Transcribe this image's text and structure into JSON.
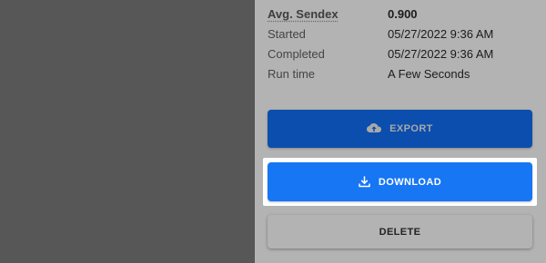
{
  "stats": [
    {
      "label": "Avg. Sendex",
      "value": "0.900"
    },
    {
      "label": "Started",
      "value": "05/27/2022 9:36 AM"
    },
    {
      "label": "Completed",
      "value": "05/27/2022 9:36 AM"
    },
    {
      "label": "Run time",
      "value": "A Few Seconds"
    }
  ],
  "actions": {
    "export_label": "EXPORT",
    "export_icon": "cloud-upload-icon",
    "download_label": "DOWNLOAD",
    "download_icon": "download-icon",
    "delete_label": "DELETE"
  },
  "colors": {
    "export_bg": "#0b4eae",
    "download_bg": "#1676f3",
    "panel_bg": "#b3b3b3",
    "overlay_bg": "#575757"
  }
}
